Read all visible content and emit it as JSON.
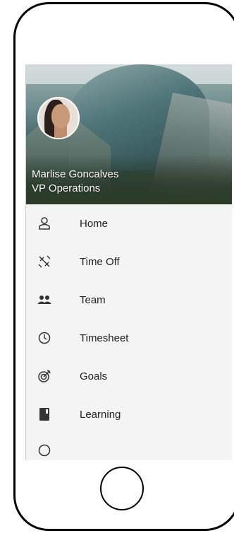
{
  "profile": {
    "name": "Marlise Goncalves",
    "title": "VP Operations"
  },
  "menu": {
    "items": [
      {
        "label": "Home",
        "icon": "home-icon"
      },
      {
        "label": "Time Off",
        "icon": "airplane-icon"
      },
      {
        "label": "Team",
        "icon": "team-icon"
      },
      {
        "label": "Timesheet",
        "icon": "clock-icon"
      },
      {
        "label": "Goals",
        "icon": "target-icon"
      },
      {
        "label": "Learning",
        "icon": "book-icon"
      }
    ]
  },
  "colors": {
    "menu_background": "#f4f4f4",
    "label_text": "#222222",
    "profile_text": "#ffffff"
  }
}
